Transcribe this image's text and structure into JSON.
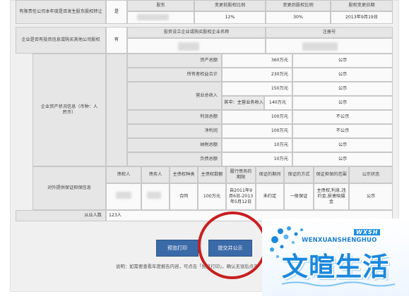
{
  "row1": {
    "label": "有限责任公司本年度是否发生股东股权转让",
    "answer": "是",
    "headers": [
      "股东",
      "变更前股权比例",
      "变更后股权比例",
      "股权变更日期"
    ],
    "values": [
      "12%",
      "30%",
      "2013年9月19日"
    ]
  },
  "row2": {
    "label": "企业是否有投资信息或购买其他公司股权",
    "answer": "有",
    "headers": [
      "投资设立企业或购买股权企业名称",
      "注册号"
    ]
  },
  "assets": {
    "label": "企业资产状况信息（币种：人民币）",
    "rows": [
      {
        "name": "资产总额",
        "value": "360万元",
        "status": "公示"
      },
      {
        "name": "所有者权益合计",
        "value": "230万元",
        "status": "公示"
      },
      {
        "name": "营业总收入",
        "value": "150万元",
        "status": "公示"
      },
      {
        "name": "其中：主营业务收入",
        "value": "140万元",
        "status": "公示"
      },
      {
        "name": "利润总额",
        "value": "100万元",
        "status": "不公示"
      },
      {
        "name": "净利润",
        "value": "100万元",
        "status": "不公示"
      },
      {
        "name": "纳税总额",
        "value": "10万元",
        "status": "公示"
      },
      {
        "name": "负债总额",
        "value": "10万元",
        "status": "公示"
      }
    ]
  },
  "guarantee": {
    "label": "对外提供保证担保信息",
    "headers": [
      "债权人",
      "债务人",
      "主债权种类",
      "主债权数额",
      "履行债务的期限",
      "保证的期间",
      "保证的方式",
      "保证担保的范围",
      "公示状态"
    ],
    "values": [
      "",
      "",
      "合同",
      "100万元",
      "自2011年9月6日-2013年5月12日",
      "未约定",
      "一般保证",
      "主债权,利息,违约金,损害赔偿金",
      "公示"
    ]
  },
  "employees": {
    "label": "从业人数",
    "value": "123人"
  },
  "buttons": {
    "preview": "预览打印",
    "submit": "提交并公示"
  },
  "note": "说明：如需要查看年度报告内容，可点击「预览打印」，确认无误后点击",
  "logo": {
    "en": "WENXUANSHENGHUO",
    "badge": "WXSH",
    "zh": "文暄生活"
  },
  "colors": {
    "button": "#3b6aa8",
    "circle": "#c81f1f",
    "logo": "#1a88dd"
  }
}
